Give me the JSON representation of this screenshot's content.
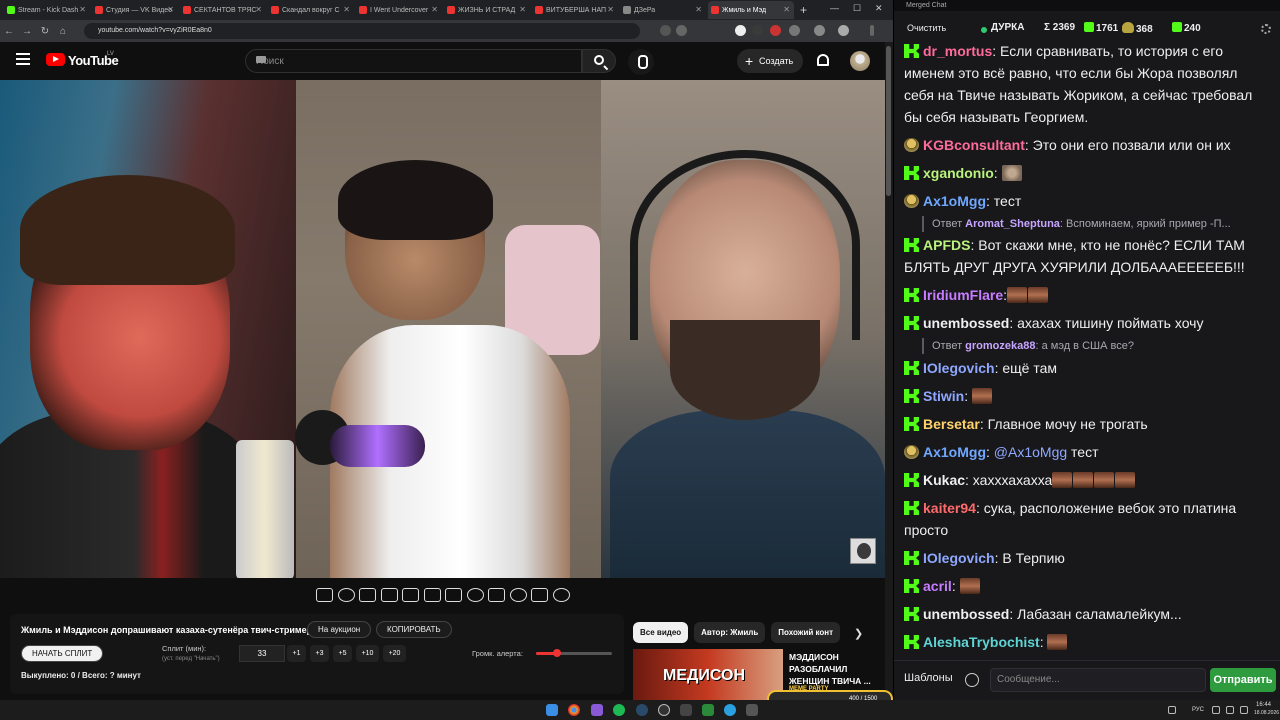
{
  "browser": {
    "tabs": [
      {
        "label": "Stream - Kick Dash",
        "color": "#53fc18"
      },
      {
        "label": "Студия — VK Видео",
        "color": "#e33"
      },
      {
        "label": "СЕКТАНТОВ ТРЯС",
        "color": "#e33"
      },
      {
        "label": "Скандал вокруг С",
        "color": "#e33"
      },
      {
        "label": "I Went Undercover",
        "color": "#e33"
      },
      {
        "label": "ЖИЗНЬ И СТРАД",
        "color": "#e33"
      },
      {
        "label": "ВИТУБЕРША НАП",
        "color": "#e33"
      },
      {
        "label": "ДЗеРа",
        "color": "#888"
      },
      {
        "label": "Жмиль и Мэд",
        "color": "#e33"
      }
    ],
    "url": "youtube.com/watch?v=vyZiR0Ea8n0"
  },
  "youtube": {
    "logo_text": "YouTube",
    "country": "LV",
    "search_placeholder": "Поиск",
    "create_label": "Создать"
  },
  "panel": {
    "title": "Жмиль и Мэддисон допрашивают казаха-сутенёра твич-стримерш",
    "auction_label": "На аукцион",
    "copy_label": "КОПИРОВАТЬ",
    "start_split_label": "НАЧАТЬ СПЛИТ",
    "split_label": "Сплит (мин):",
    "split_hint": "(уст. перед \"Начать\")",
    "split_value": "33",
    "chips": [
      "+1",
      "+3",
      "+5",
      "+10",
      "+20"
    ],
    "alert_volume_label": "Громк. алерта:",
    "alert_volume": 0.27,
    "status": "Выкуплено: 0 / Всего: ? минут"
  },
  "recommendations": {
    "chips": [
      "Все видео",
      "Автор: Жмиль",
      "Похожий конт"
    ],
    "thumb_text": "МЕДИСОН",
    "title": "МЭДДИСОН РАЗОБЛАЧИЛ ЖЕНЩИН ТВИЧА ..."
  },
  "chat": {
    "window_title": "Merged Chat",
    "clear_label": "Очистить",
    "channel": "ДУРКА",
    "total": "Σ 2369",
    "kick_count": "1761",
    "twitch_count": "368",
    "other_count": "240",
    "messages": [
      {
        "platform": "kick",
        "user": "dr_mortus",
        "color": "#ff6b9a",
        "text": ": Если сравнивать, то история с его именем это всё равно, что если бы Жора позволял себя на Твиче называть Жориком, а сейчас требовал бы себя называть Георгием."
      },
      {
        "platform": "twitch",
        "user": "KGBconsultant",
        "color": "#ff6b9a",
        "text": ": Это они его позвали или он их"
      },
      {
        "platform": "kick",
        "user": "xgandonio",
        "color": "#b9f27c",
        "text": ":"
      },
      {
        "platform": "twitch",
        "user": "Ax1oMgg",
        "color": "#6fa8ff",
        "text": ": тест"
      },
      {
        "platform": "kick",
        "user": "APFDS",
        "color": "#b9f27c",
        "text": ": Вот скажи мне, кто не понёс? ЕСЛИ ТАМ БЛЯТЬ ДРУГ ДРУГА ХУЯРИЛИ ДОЛБАААЕЕЕЕЕБ!!!"
      },
      {
        "platform": "kick",
        "user": "IridiumFlare",
        "color": "#c77dff",
        "text": ":"
      },
      {
        "platform": "kick",
        "user": "unembossed",
        "color": "#efeff1",
        "text": ": ахахах тишину поймать хочу"
      },
      {
        "platform": "kick",
        "user": "IOlegovich",
        "color": "#8fa8ff",
        "text": ": ещё там"
      },
      {
        "platform": "kick",
        "user": "Stiwin",
        "color": "#8fa8ff",
        "text": ":"
      },
      {
        "platform": "kick",
        "user": "Bersetar",
        "color": "#ffd36b",
        "text": ": Главное мочу не трогать"
      },
      {
        "platform": "twitch",
        "user": "Ax1oMgg",
        "color": "#6fa8ff",
        "mention": "@Ax1oMgg",
        "text": " тест"
      },
      {
        "platform": "kick",
        "user": "Kukac",
        "color": "#efeff1",
        "text": ": хахххахахха"
      },
      {
        "platform": "kick",
        "user": "kaiter94",
        "color": "#ff6b6b",
        "text": ": сука, расположение вебок это платина просто"
      },
      {
        "platform": "kick",
        "user": "IOlegovich",
        "color": "#8fa8ff",
        "text": ": В Терпию"
      },
      {
        "platform": "kick",
        "user": "acril",
        "color": "#c77dff",
        "text": ":"
      },
      {
        "platform": "kick",
        "user": "unembossed",
        "color": "#efeff1",
        "text": ": Лабазан саламалейкум..."
      },
      {
        "platform": "kick",
        "user": "AleshaTrybochist",
        "color": "#5fd4d4",
        "text": ":"
      }
    ],
    "replies": [
      {
        "prefix": "Ответ ",
        "user": "Aromat_Sheptuna",
        "text": ": Вспоминаем, яркий пример -П..."
      },
      {
        "prefix": "Ответ ",
        "user": "gromozeka88",
        "text": ": а мэд в США все?"
      }
    ],
    "templates_label": "Шаблоны",
    "input_placeholder": "Сообщение...",
    "send_label": "Отправить"
  },
  "taskbar": {
    "lang": "РУС",
    "time": "16:44",
    "date": "18.08.2026"
  },
  "overlay": {
    "label": "MEME PARTY",
    "count": "400 / 1500"
  }
}
